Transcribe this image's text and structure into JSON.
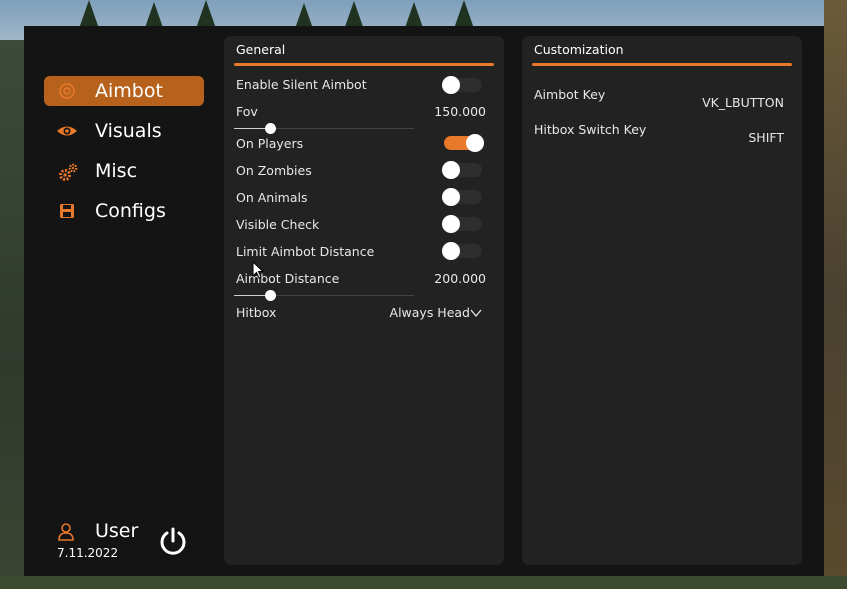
{
  "sidebar": {
    "items": [
      {
        "label": "Aimbot",
        "icon": "target-icon",
        "active": true
      },
      {
        "label": "Visuals",
        "icon": "eye-icon",
        "active": false
      },
      {
        "label": "Misc",
        "icon": "gears-icon",
        "active": false
      },
      {
        "label": "Configs",
        "icon": "floppy-disk-icon",
        "active": false
      }
    ],
    "user": {
      "name": "User",
      "date": "7.11.2022",
      "icon": "user-icon",
      "power_icon": "power-icon"
    }
  },
  "general": {
    "title": "General",
    "enable_silent_aimbot": {
      "label": "Enable Silent Aimbot",
      "on": false
    },
    "fov": {
      "label": "Fov",
      "value": "150.000",
      "fraction": 0.2
    },
    "on_players": {
      "label": "On Players",
      "on": true
    },
    "on_zombies": {
      "label": "On Zombies",
      "on": false
    },
    "on_animals": {
      "label": "On Animals",
      "on": false
    },
    "visible_check": {
      "label": "Visible Check",
      "on": false
    },
    "limit_aimbot_distance": {
      "label": "Limit Aimbot Distance",
      "on": false
    },
    "aimbot_distance": {
      "label": "Aimbot Distance",
      "value": "200.000",
      "fraction": 0.2
    },
    "hitbox": {
      "label": "Hitbox",
      "value": "Always Head"
    }
  },
  "customization": {
    "title": "Customization",
    "aimbot_key": {
      "label": "Aimbot Key",
      "value": "VK_LBUTTON"
    },
    "hitbox_switch_key": {
      "label": "Hitbox Switch Key",
      "value": "SHIFT"
    }
  },
  "colors": {
    "accent": "#e8782a",
    "active_nav": "#b7621c",
    "panel": "#222222",
    "window": "#141414"
  }
}
